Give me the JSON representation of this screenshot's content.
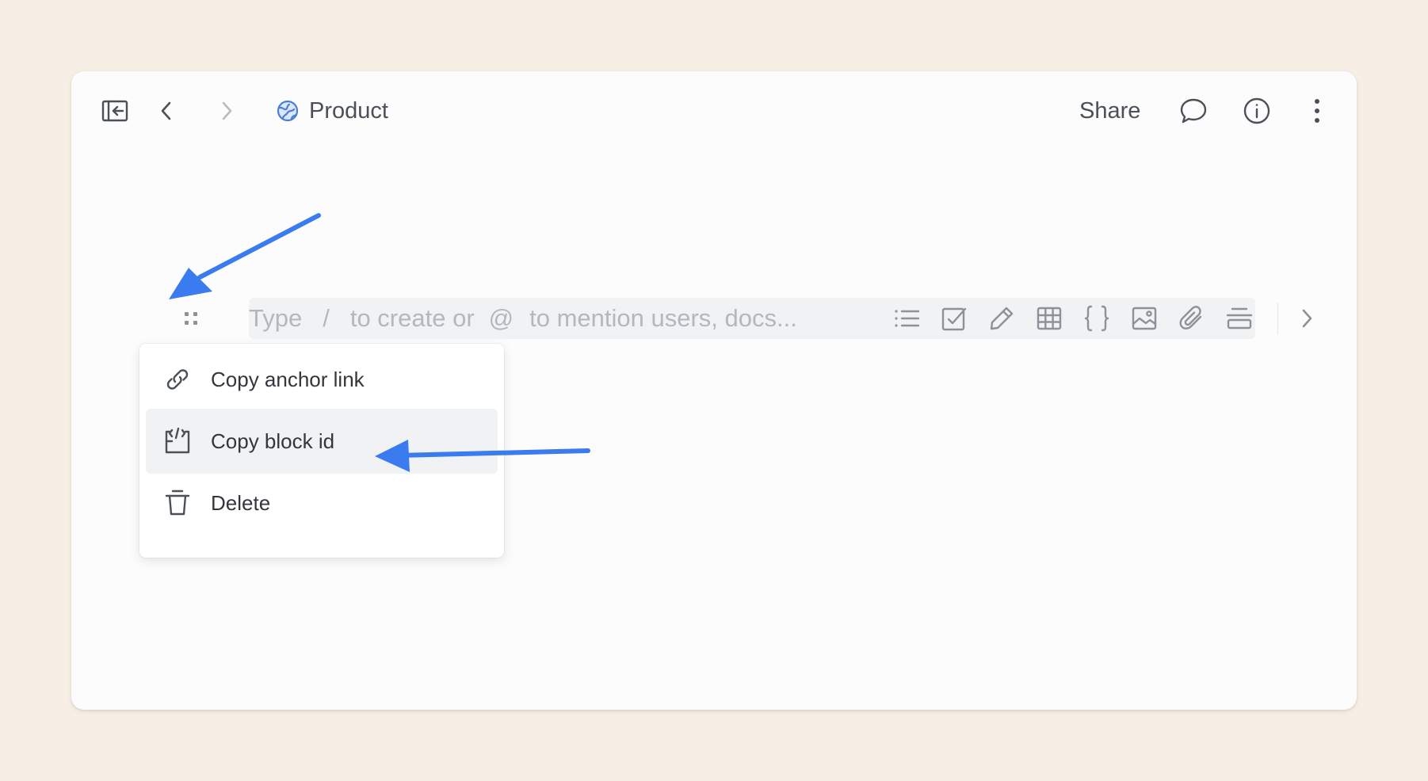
{
  "topbar": {
    "doc_title": "Product",
    "share_label": "Share",
    "icons": [
      "sidebar-collapse-icon",
      "back-icon",
      "forward-icon",
      "doc-globe-icon",
      "comment-icon",
      "info-icon",
      "more-vertical-icon"
    ]
  },
  "editor": {
    "placeholder": {
      "part1": "Type",
      "slash": "/",
      "part2": "to create or",
      "at": "@",
      "part3": "to mention users, docs..."
    },
    "tools": [
      "bulleted-list-icon",
      "checkbox-icon",
      "pencil-icon",
      "table-icon",
      "code-braces-icon",
      "image-icon",
      "attachment-icon",
      "divider-icon",
      "chevron-right-icon"
    ]
  },
  "context_menu": {
    "items": [
      {
        "label": "Copy anchor link",
        "icon": "link-icon"
      },
      {
        "label": "Copy block id",
        "icon": "block-id-icon"
      },
      {
        "label": "Delete",
        "icon": "trash-icon"
      }
    ],
    "highlighted_index": 1
  },
  "annotations": {
    "arrow_color": "#3b7bf0"
  },
  "colors": {
    "background": "#f7efe6",
    "window": "#fcfcfc",
    "text": "#4b5058",
    "placeholder": "#b3b7bf",
    "accent": "#3b7bf0"
  }
}
